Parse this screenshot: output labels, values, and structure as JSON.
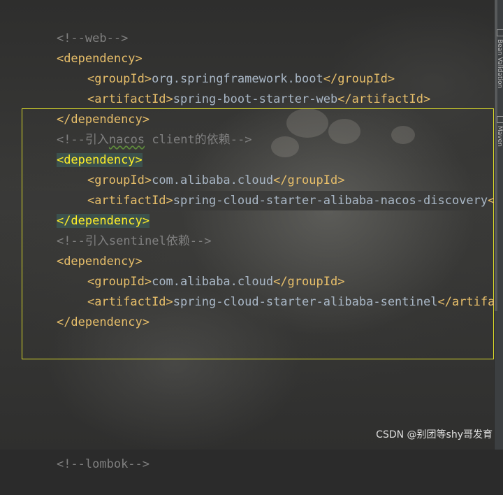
{
  "editor": {
    "lines": [
      {
        "type": "comment",
        "text": "<!--web-->"
      },
      {
        "type": "tag",
        "text": "<dependency>"
      },
      {
        "type": "element",
        "indent": 1,
        "open": "<groupId>",
        "value": "org.springframework.boot",
        "close": "</groupId>"
      },
      {
        "type": "element",
        "indent": 1,
        "open": "<artifactId>",
        "value": "spring-boot-starter-web",
        "close": "</artifactId>"
      },
      {
        "type": "tag",
        "text": "</dependency>"
      },
      {
        "type": "comment-split",
        "pre": "<!--引入",
        "underlined": "nacos",
        "post": " client的依赖-->"
      },
      {
        "type": "tag-matched",
        "text": "<dependency>"
      },
      {
        "type": "element",
        "indent": 1,
        "open": "<groupId>",
        "value": "com.alibaba.cloud",
        "close": "</groupId>"
      },
      {
        "type": "element-partial",
        "indent": 1,
        "open": "<artifactId>",
        "value": "spring-cloud-starter-alibaba-nacos-discovery",
        "close": "<"
      },
      {
        "type": "tag-matched",
        "text": "</dependency>"
      },
      {
        "type": "comment",
        "text": "<!--引入sentinel依赖-->"
      },
      {
        "type": "tag",
        "text": "<dependency>"
      },
      {
        "type": "element",
        "indent": 1,
        "open": "<groupId>",
        "value": "com.alibaba.cloud",
        "close": "</groupId>"
      },
      {
        "type": "element-partial",
        "indent": 1,
        "open": "<artifactId>",
        "value": "spring-cloud-starter-alibaba-sentinel",
        "close": "</artifa"
      },
      {
        "type": "tag",
        "text": "</dependency>"
      },
      {
        "type": "comment",
        "text": "<!--lombok-->",
        "bottom": true
      }
    ]
  },
  "side_tabs": [
    {
      "label": "Bean Validation"
    },
    {
      "label": "Maven"
    }
  ],
  "watermark": "CSDN @别团等shy哥发育",
  "colors": {
    "tag": "#e8bf6a",
    "text": "#a9b7c6",
    "comment": "#808080",
    "selection_border": "#d8d82a",
    "matched_tag_bg": "#3b514d"
  }
}
